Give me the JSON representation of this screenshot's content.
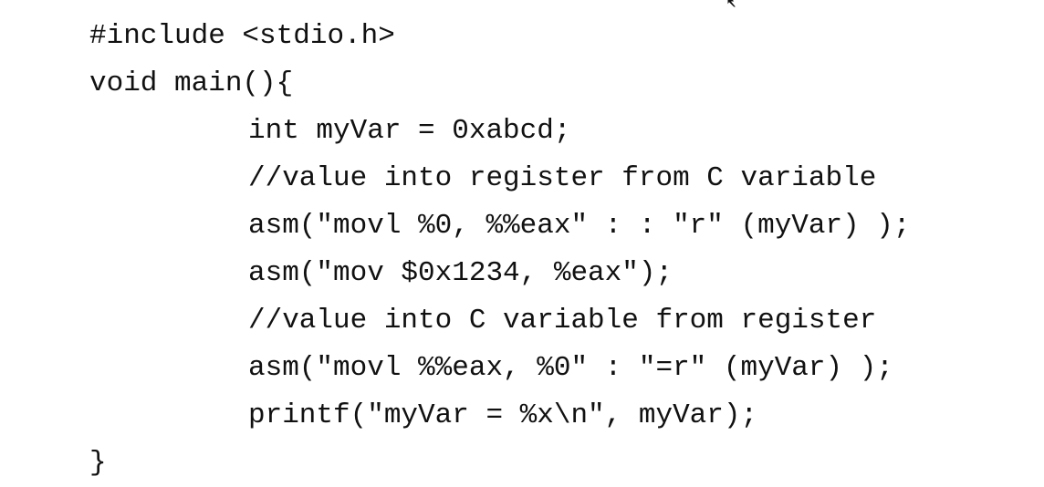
{
  "code": {
    "lines": [
      "#include <stdio.h>",
      "void main(){",
      "int myVar = 0xabcd;",
      "//value into register from C variable",
      "asm(\"movl %0, %%eax\" : : \"r\" (myVar) );",
      "asm(\"mov $0x1234, %eax\");",
      "//value into C variable from register",
      "asm(\"movl %%eax, %0\" : \"=r\" (myVar) );",
      "printf(\"myVar = %x\\n\", myVar);",
      "}"
    ]
  },
  "cursor_icon": "mouse-pointer-icon"
}
